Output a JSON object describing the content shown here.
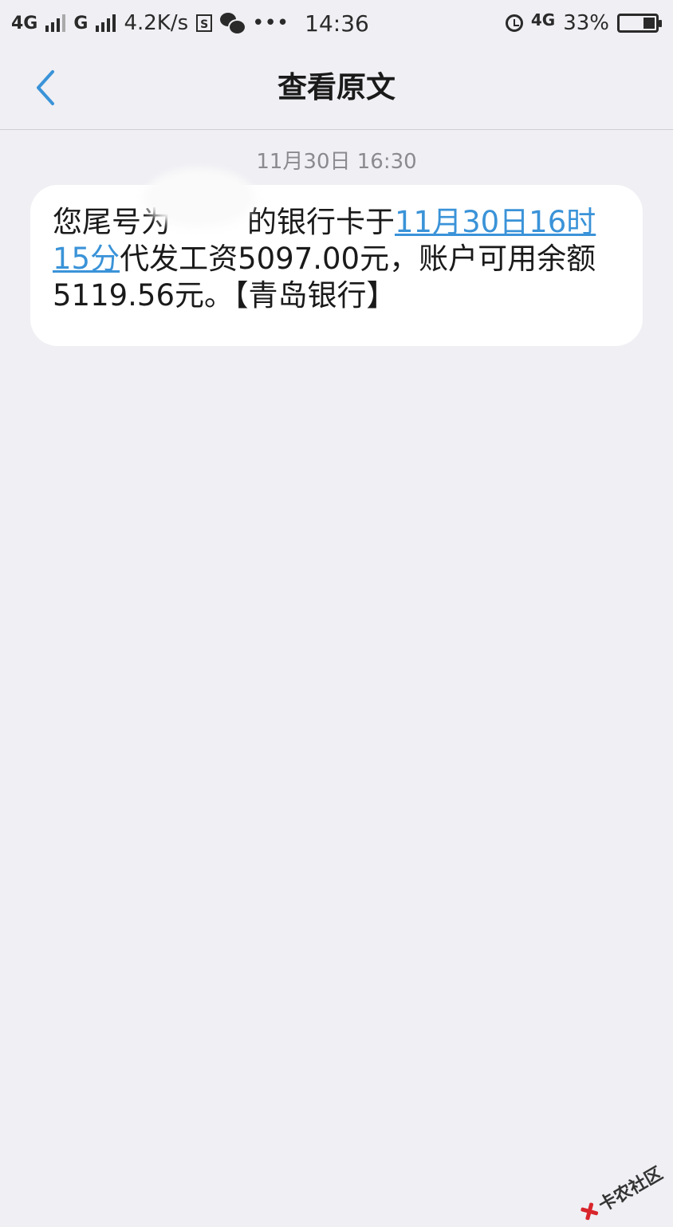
{
  "status_bar": {
    "net1": "4G",
    "net2": "G",
    "speed": "4.2K/s",
    "sim_icon": "S",
    "time": "14:36",
    "net3": "4G",
    "battery_pct": "33%",
    "battery_level": 0.33
  },
  "nav": {
    "title": "查看原文"
  },
  "message": {
    "timestamp": "11月30日 16:30",
    "text_before": "您尾号为",
    "text_after_redact": "的银行卡于",
    "link_text": "11月30日16时15分",
    "text_rest": "代发工资5097.00元，账户可用余额5119.56元。【青岛银行】"
  },
  "watermark": {
    "text": "卡农社区"
  }
}
